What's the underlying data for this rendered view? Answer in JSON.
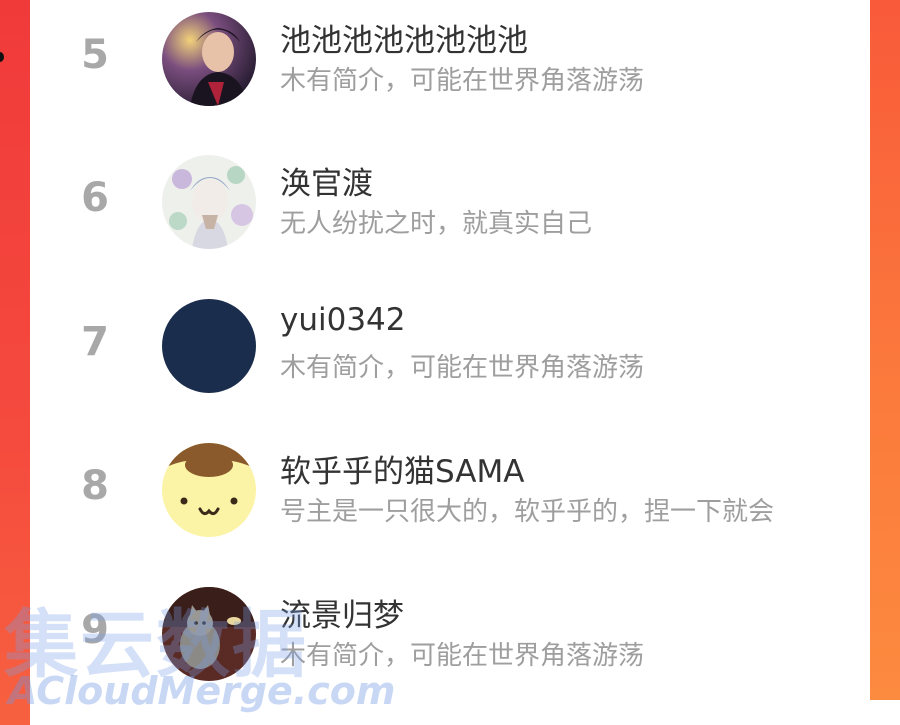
{
  "colors": {
    "accent_left": "#f03a3a",
    "accent_right": "#fb7a3c",
    "rank_color": "#a8a8a8",
    "name_color": "#333333",
    "bio_color": "#9e9e9e"
  },
  "ranking": {
    "items": [
      {
        "rank": "5",
        "name": "池池池池池池池池",
        "bio": "木有简介，可能在世界角落游荡",
        "avatar_icon": "anime-character-avatar"
      },
      {
        "rank": "6",
        "name": "涣官渡",
        "bio": "无人纷扰之时，就真实自己",
        "avatar_icon": "flower-illustration-avatar"
      },
      {
        "rank": "7",
        "name": "yui0342",
        "bio": "木有简介，可能在世界角落游荡",
        "avatar_icon": "navy-circle-avatar"
      },
      {
        "rank": "8",
        "name": "软乎乎的猫SAMA",
        "bio": "号主是一只很大的，软乎乎的，捏一下就会",
        "avatar_icon": "pompompurin-avatar"
      },
      {
        "rank": "9",
        "name": "流景归梦",
        "bio": "木有简介，可能在世界角落游荡",
        "avatar_icon": "cat-photo-avatar"
      }
    ]
  },
  "watermark": {
    "text_cn": "集云数据",
    "text_en": "ACloudMerge.com"
  }
}
